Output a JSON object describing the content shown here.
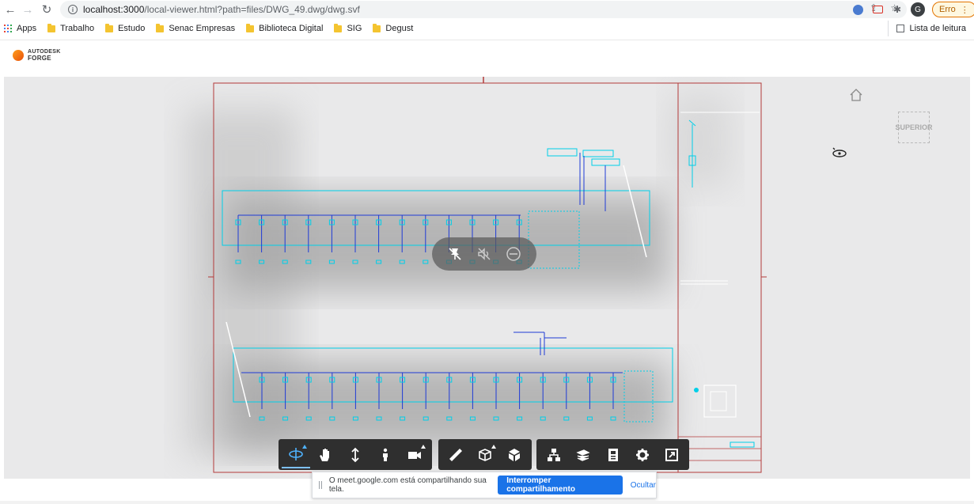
{
  "browser": {
    "url_host": "localhost:3000",
    "url_path": "/local-viewer.html?path=files/DWG_49.dwg/dwg.svf",
    "profile_initial": "G",
    "error_label": "Erro"
  },
  "bookmarks": {
    "apps_label": "Apps",
    "items": [
      "Trabalho",
      "Estudo",
      "Senac Empresas",
      "Biblioteca Digital",
      "SIG",
      "Degust"
    ],
    "reading_list": "Lista de leitura"
  },
  "forge": {
    "logo_line1": "AUTODESK",
    "logo_line2": "FORGE"
  },
  "viewer": {
    "viewcube_label": "SUPERIOR"
  },
  "sharebar": {
    "message": "O meet.google.com está compartilhando sua tela.",
    "stop_label": "Interromper compartilhamento",
    "hide_label": "Ocultar"
  },
  "icons": {
    "accent": "#4fb3ff",
    "cad_line": "#00cfe8",
    "cad_line_dark": "#1f3bd6",
    "border_red": "#b33a3a"
  }
}
